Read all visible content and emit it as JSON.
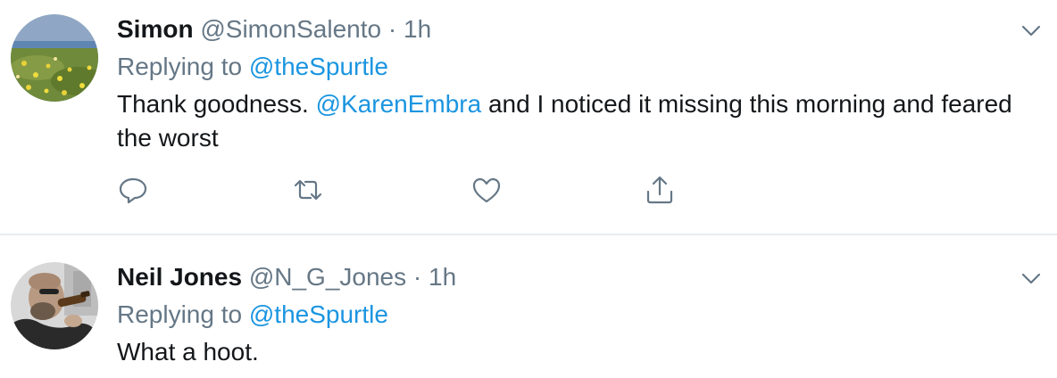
{
  "tweets": [
    {
      "name": "Simon",
      "handle": "@SimonSalento",
      "separator": "·",
      "time": "1h",
      "replying_prefix": "Replying to ",
      "replying_to": "@theSpurtle",
      "text_1": "Thank goodness. ",
      "mention": "@KarenEmbra",
      "text_2": " and I noticed it missing this morning and feared the worst",
      "avatar": "avatar-flowers-field",
      "actions": [
        "reply-icon",
        "retweet-icon",
        "like-icon",
        "share-icon"
      ]
    },
    {
      "name": "Neil Jones",
      "handle": "@N_G_Jones",
      "separator": "·",
      "time": "1h",
      "replying_prefix": "Replying to ",
      "replying_to": "@theSpurtle",
      "text": "What a hoot.",
      "avatar": "avatar-man-drinking"
    }
  ],
  "colors": {
    "link": "#1b95e0",
    "secondary": "#657786",
    "primary_text": "#14171a",
    "divider": "#e6ecf0"
  }
}
